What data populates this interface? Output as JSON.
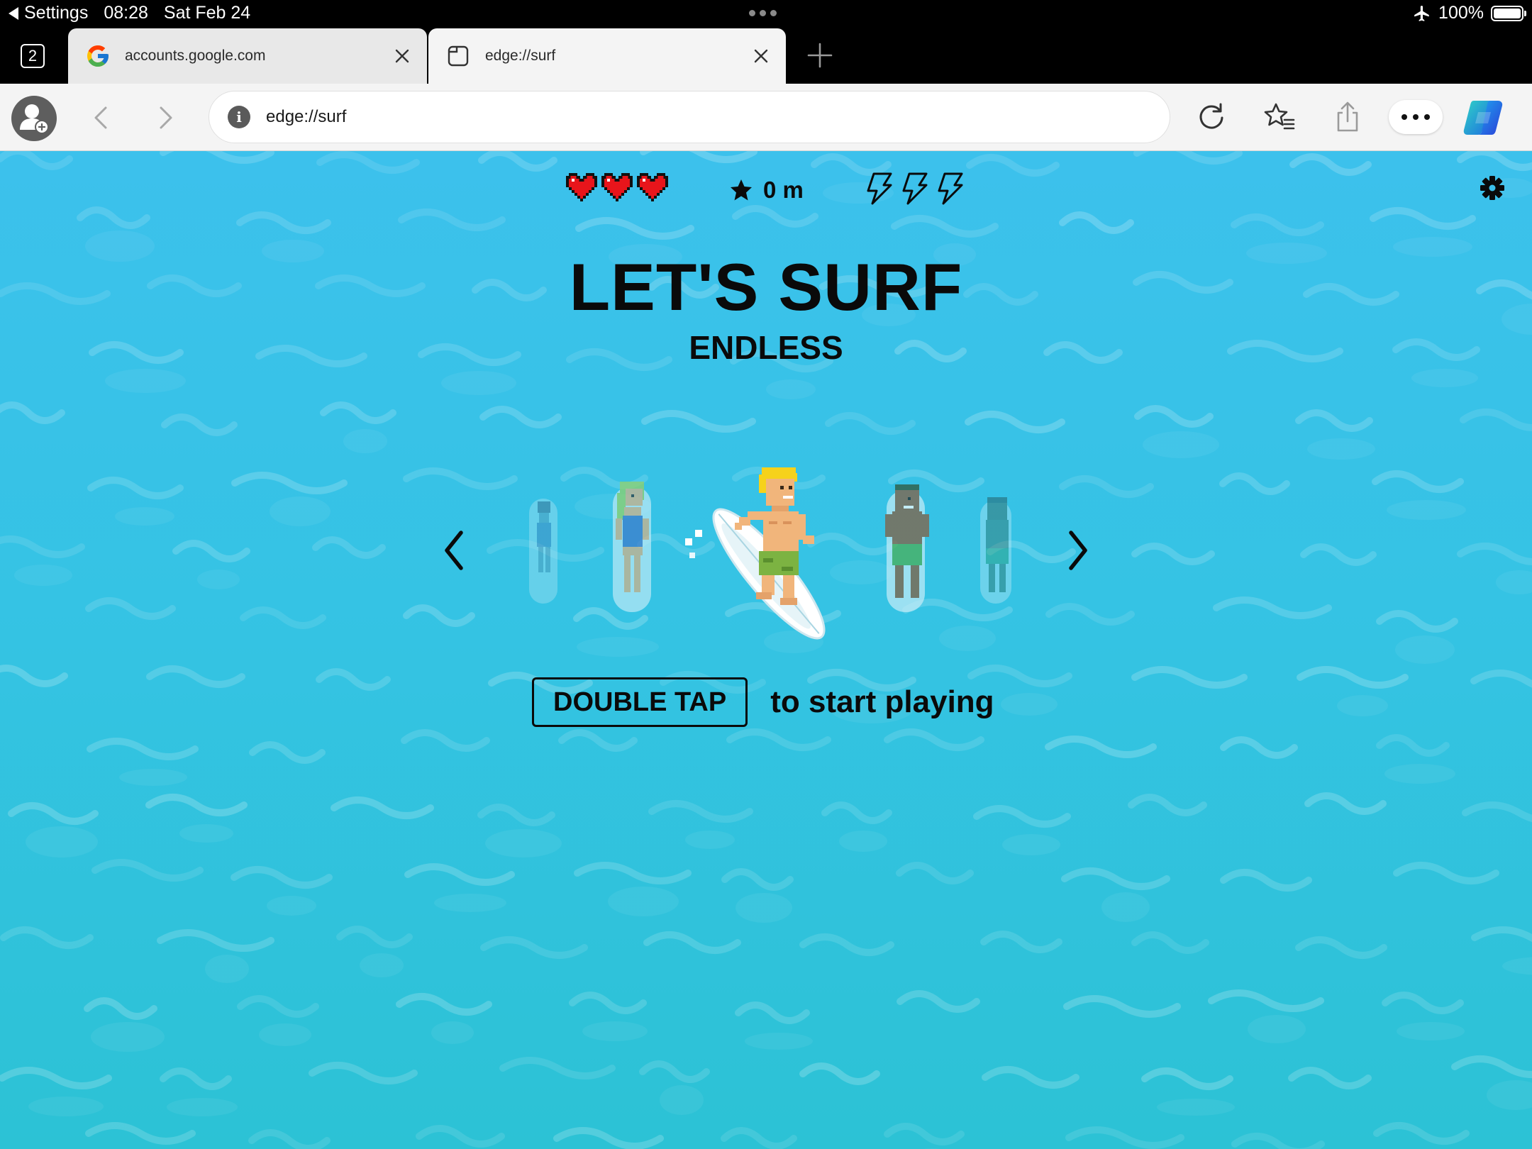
{
  "status_bar": {
    "back_app": "Settings",
    "time": "08:28",
    "date": "Sat Feb 24",
    "battery": "100%",
    "icons": [
      "back-triangle-icon",
      "airplane-icon",
      "battery-icon"
    ]
  },
  "tabs": {
    "count": "2",
    "items": [
      {
        "label": "accounts.google.com",
        "icon": "google-icon",
        "active": false
      },
      {
        "label": "edge://surf",
        "icon": "page-icon",
        "active": true
      }
    ],
    "new_tab_icon": "plus-icon"
  },
  "toolbar": {
    "url": "edge://surf",
    "info_icon_text": "i",
    "icons": [
      "profile-icon",
      "back-icon",
      "forward-icon",
      "refresh-icon",
      "favorites-icon",
      "share-icon",
      "more-icon",
      "copilot-icon"
    ]
  },
  "game": {
    "hud": {
      "lives": 3,
      "distance": "0 m",
      "boosts": 3
    },
    "title": "LET'S SURF",
    "mode": "ENDLESS",
    "start": {
      "button": "DOUBLE TAP",
      "text": "to start playing"
    },
    "selected_character": "blonde-surfer",
    "colors": {
      "water": "#3cc1ec",
      "heart": "#e8151b",
      "text": "#0a0a0a"
    }
  }
}
